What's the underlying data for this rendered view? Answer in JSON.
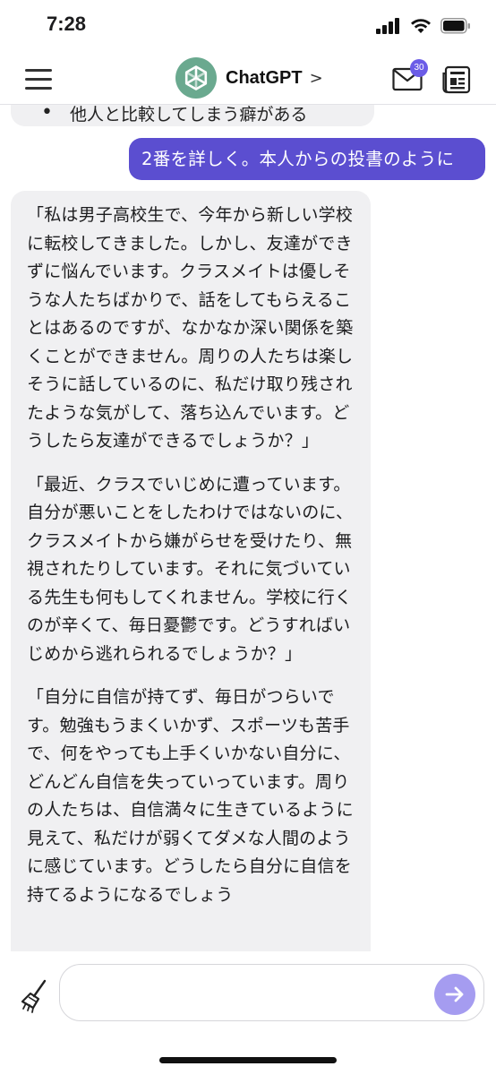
{
  "status_bar": {
    "time": "7:28"
  },
  "header": {
    "app_title": "ChatGPT",
    "title_chevron": ">",
    "mail_badge_count": "30",
    "icons": [
      "menu-icon",
      "chatgpt-logo-icon",
      "mail-icon",
      "newspaper-icon"
    ]
  },
  "messages": {
    "previous_partial": "他人と比較してしまう癖がある",
    "user_message": "2番を詳しく。本人からの投書のように",
    "assistant_paragraphs": [
      "「私は男子高校生で、今年から新しい学校に転校してきました。しかし、友達ができずに悩んでいます。クラスメイトは優しそうな人たちばかりで、話をしてもらえることはあるのですが、なかなか深い関係を築くことができません。周りの人たちは楽しそうに話しているのに、私だけ取り残されたような気がして、落ち込んでいます。どうしたら友達ができるでしょうか？」",
      "「最近、クラスでいじめに遭っています。自分が悪いことをしたわけではないのに、クラスメイトから嫌がらせを受けたり、無視されたりしています。それに気づいている先生も何もしてくれません。学校に行くのが辛くて、毎日憂鬱です。どうすればいじめから逃れられるでしょうか？」",
      "「自分に自信が持てず、毎日がつらいです。勉強もうまくいかず、スポーツも苦手で、何をやっても上手くいかない自分に、どんどん自信を失っていっています。周りの人たちは、自信満々に生きているように見えて、私だけが弱くてダメな人間のように感じています。どうしたら自分に自信を持てるようになるでしょう"
    ]
  },
  "composer": {
    "input_value": "",
    "input_placeholder": "",
    "icons": [
      "broom-icon",
      "send-arrow-icon"
    ]
  },
  "colors": {
    "accent": "#5b4ed0",
    "send_button": "#a59cf0",
    "assistant_bubble": "#f0f0f2",
    "logo_green": "#6aa98f"
  }
}
